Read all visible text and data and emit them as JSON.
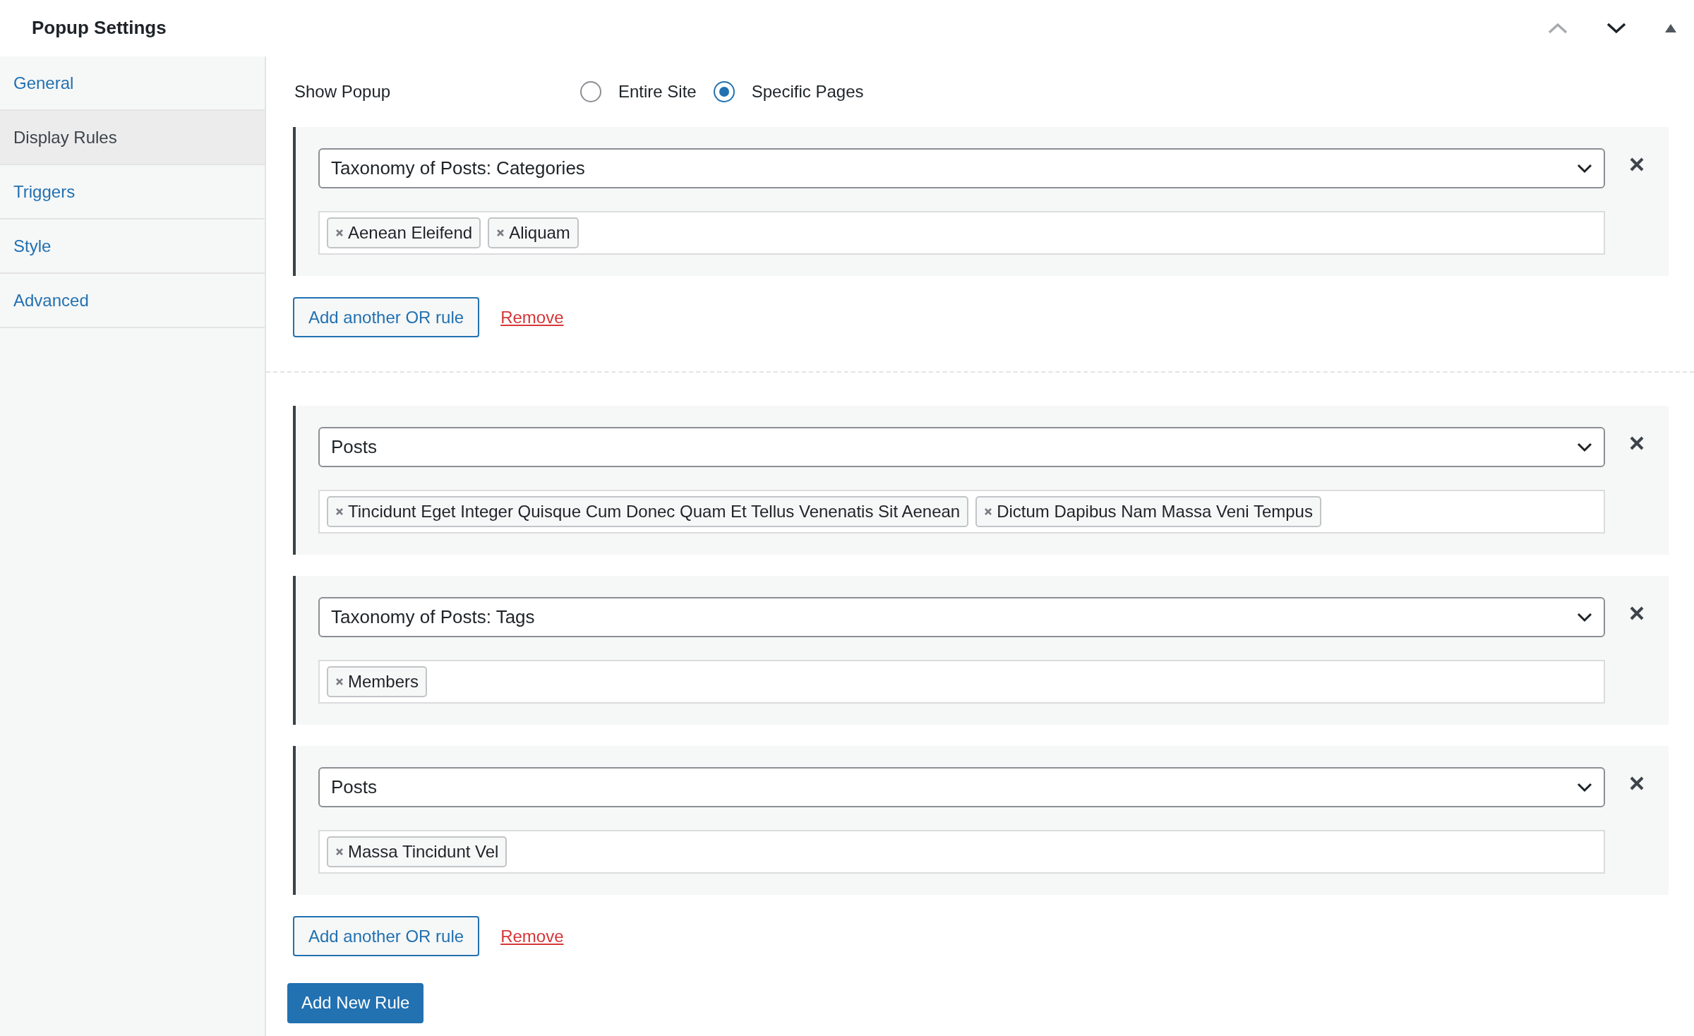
{
  "header": {
    "title": "Popup Settings"
  },
  "sidebar": {
    "items": [
      {
        "label": "General",
        "selected": false
      },
      {
        "label": "Display Rules",
        "selected": true
      },
      {
        "label": "Triggers",
        "selected": false
      },
      {
        "label": "Style",
        "selected": false
      },
      {
        "label": "Advanced",
        "selected": false
      }
    ]
  },
  "show_popup": {
    "label": "Show Popup",
    "options": [
      {
        "label": "Entire Site",
        "selected": false
      },
      {
        "label": "Specific Pages",
        "selected": true
      }
    ]
  },
  "groups": [
    {
      "rules": [
        {
          "select": "Taxonomy of Posts: Categories",
          "tags": [
            "Aenean Eleifend",
            "Aliquam"
          ]
        }
      ],
      "add_button": "Add another OR rule",
      "remove_link": "Remove"
    },
    {
      "rules": [
        {
          "select": "Posts",
          "tags": [
            "Tincidunt Eget Integer Quisque Cum Donec Quam Et Tellus Venenatis Sit Aenean",
            "Dictum Dapibus Nam Massa Veni Tempus"
          ]
        },
        {
          "select": "Taxonomy of Posts: Tags",
          "tags": [
            "Members"
          ]
        },
        {
          "select": "Posts",
          "tags": [
            "Massa Tincidunt Vel"
          ]
        }
      ],
      "add_button": "Add another OR rule",
      "remove_link": "Remove"
    }
  ],
  "add_rule_button": "Add New Rule"
}
